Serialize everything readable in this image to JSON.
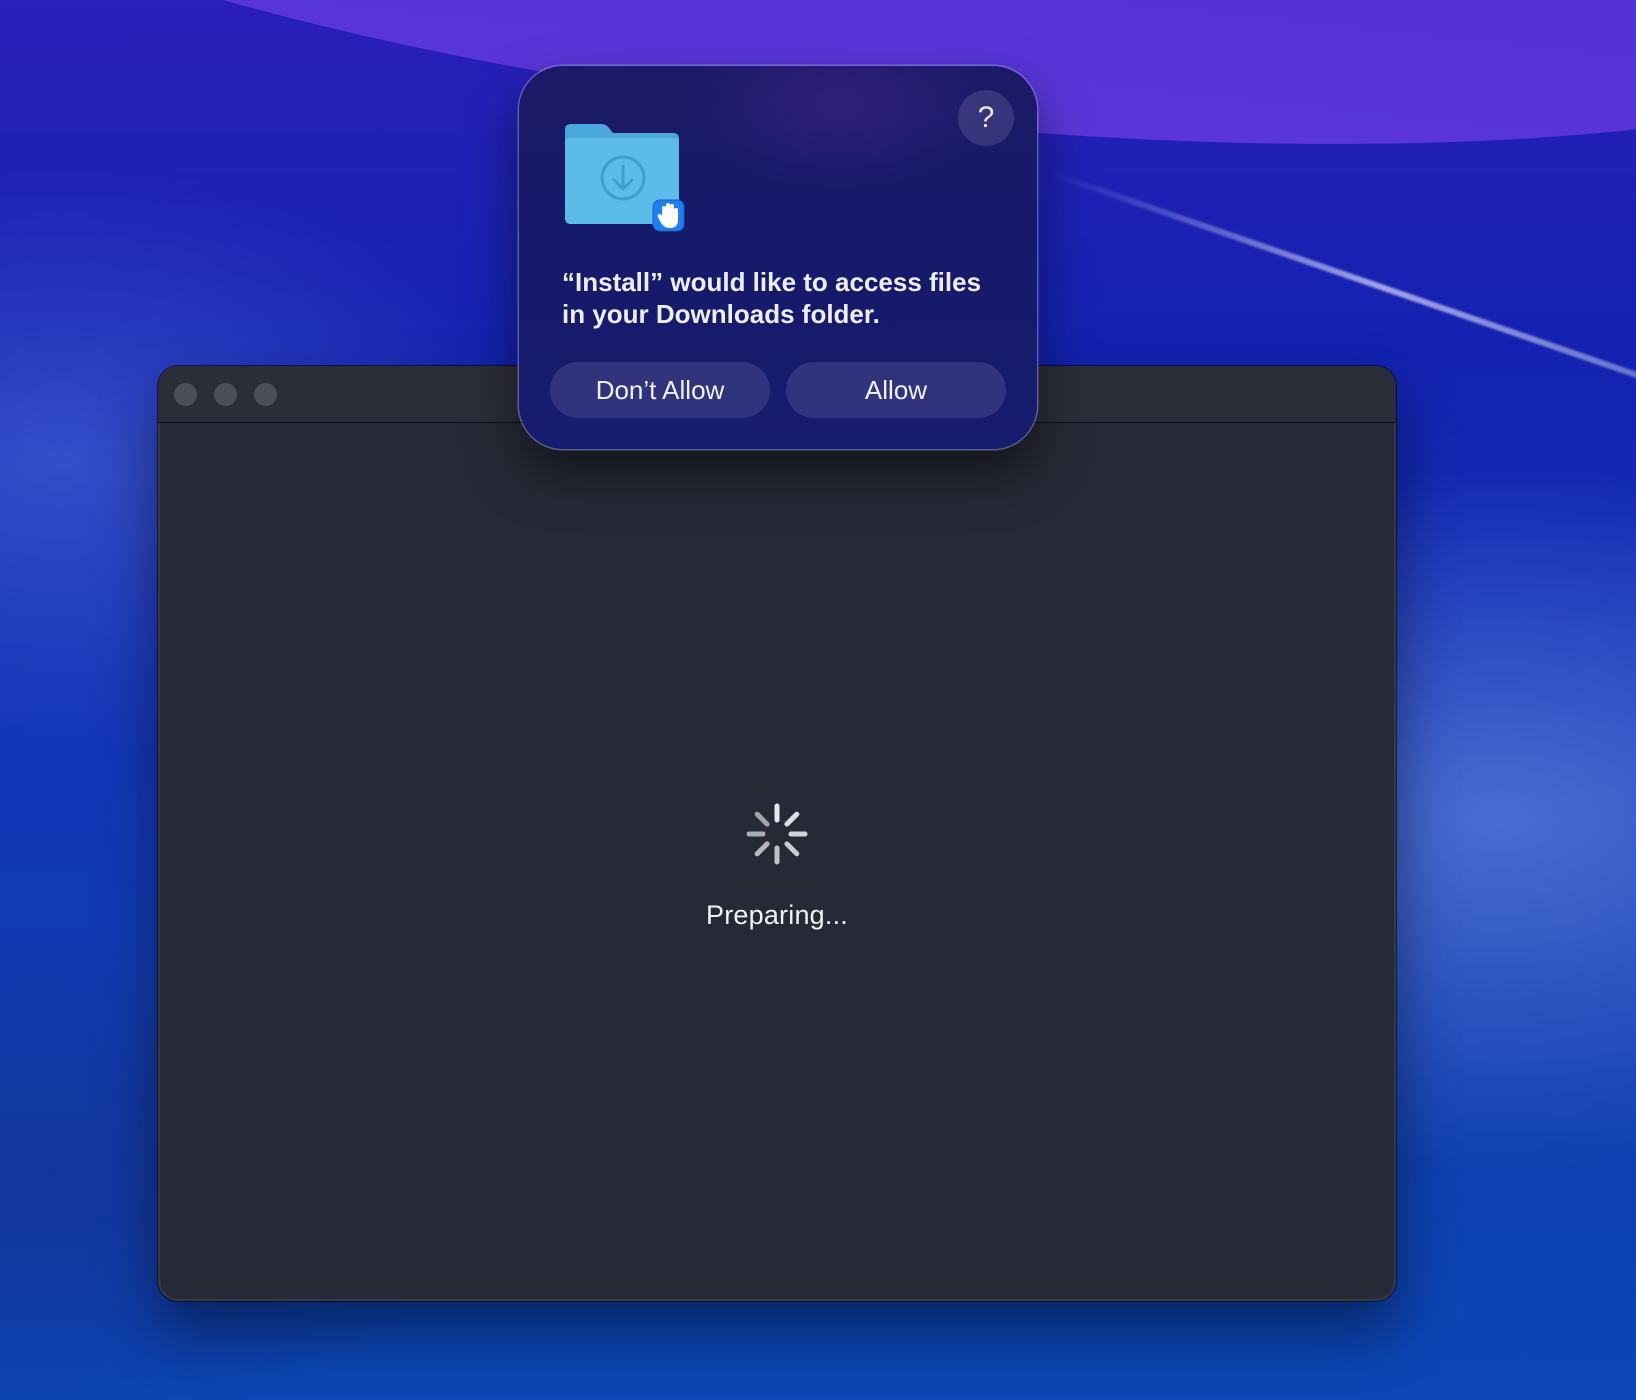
{
  "installer_window": {
    "status_text": "Preparing..."
  },
  "permission_dialog": {
    "message": "“Install” would like to access files in your Downloads folder.",
    "help_label": "?",
    "dont_allow_label": "Don’t Allow",
    "allow_label": "Allow"
  },
  "icons": {
    "folder": "downloads-folder-icon",
    "badge": "hand-stop-icon",
    "spinner": "loading-spinner-icon"
  },
  "colors": {
    "folder": "#5bbce9",
    "badge": "#1f7ff0",
    "window_bg": "#262a36",
    "dialog_bg": "#17196a"
  }
}
